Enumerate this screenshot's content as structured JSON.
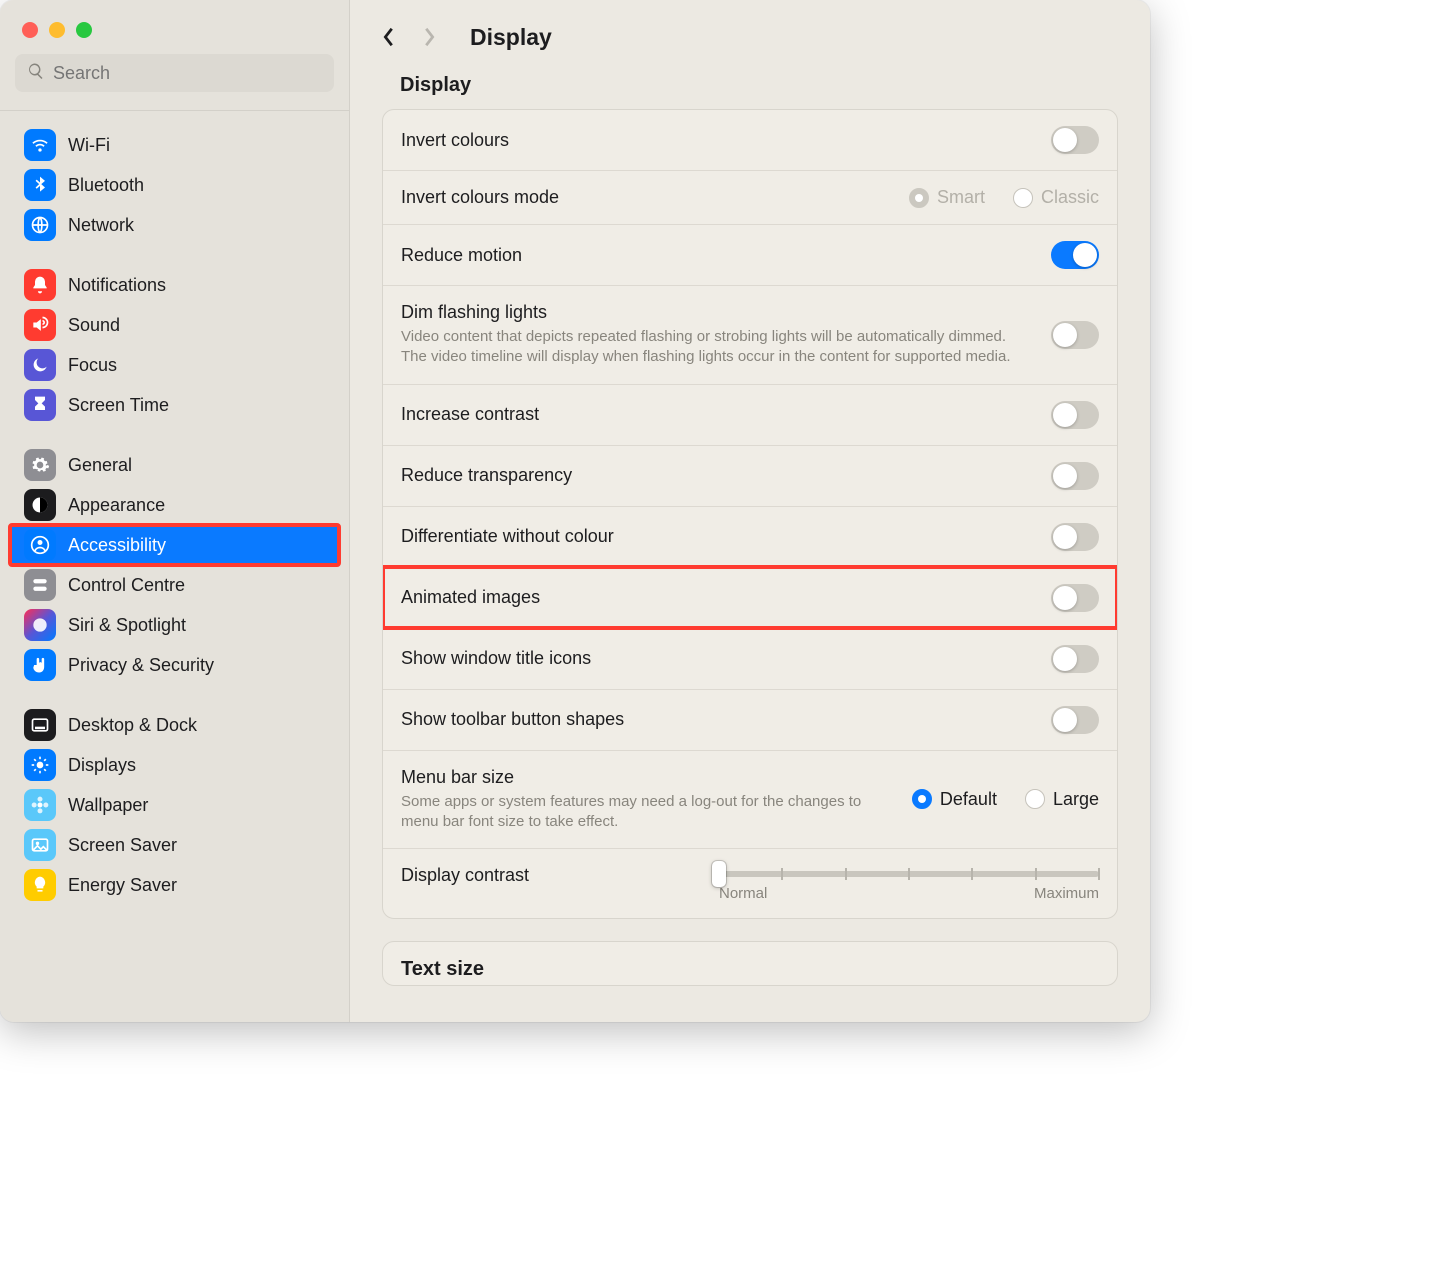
{
  "search": {
    "placeholder": "Search"
  },
  "sidebar": {
    "group1": [
      {
        "label": "Wi-Fi",
        "icon": "wifi-icon",
        "cls": "ic-wifi"
      },
      {
        "label": "Bluetooth",
        "icon": "bluetooth-icon",
        "cls": "ic-bluetooth"
      },
      {
        "label": "Network",
        "icon": "globe-icon",
        "cls": "ic-network"
      }
    ],
    "group2": [
      {
        "label": "Notifications",
        "icon": "bell-icon",
        "cls": "ic-notif"
      },
      {
        "label": "Sound",
        "icon": "speaker-icon",
        "cls": "ic-sound"
      },
      {
        "label": "Focus",
        "icon": "moon-icon",
        "cls": "ic-focus"
      },
      {
        "label": "Screen Time",
        "icon": "hourglass-icon",
        "cls": "ic-screentime"
      }
    ],
    "group3": [
      {
        "label": "General",
        "icon": "gear-icon",
        "cls": "ic-general"
      },
      {
        "label": "Appearance",
        "icon": "contrast-icon",
        "cls": "ic-appearance"
      },
      {
        "label": "Accessibility",
        "icon": "person-circle-icon",
        "cls": "ic-accessibility",
        "selected": true,
        "highlighted": true
      },
      {
        "label": "Control Centre",
        "icon": "switches-icon",
        "cls": "ic-control"
      },
      {
        "label": "Siri & Spotlight",
        "icon": "siri-icon",
        "cls": "ic-siri"
      },
      {
        "label": "Privacy & Security",
        "icon": "hand-icon",
        "cls": "ic-privacy"
      }
    ],
    "group4": [
      {
        "label": "Desktop & Dock",
        "icon": "dock-icon",
        "cls": "ic-desktop"
      },
      {
        "label": "Displays",
        "icon": "sun-icon",
        "cls": "ic-displays"
      },
      {
        "label": "Wallpaper",
        "icon": "flower-icon",
        "cls": "ic-wallpaper"
      },
      {
        "label": "Screen Saver",
        "icon": "photo-icon",
        "cls": "ic-screensaver"
      },
      {
        "label": "Energy Saver",
        "icon": "bulb-icon",
        "cls": "ic-energy"
      }
    ]
  },
  "page": {
    "title": "Display",
    "section": "Display"
  },
  "rows": {
    "invert": {
      "label": "Invert colours",
      "type": "toggle",
      "on": false
    },
    "invert_mode": {
      "label": "Invert colours mode",
      "type": "radio",
      "options": [
        {
          "label": "Smart",
          "selected": true
        },
        {
          "label": "Classic",
          "selected": false
        }
      ],
      "disabled": true
    },
    "reduce_motion": {
      "label": "Reduce motion",
      "type": "toggle",
      "on": true
    },
    "dim_flashing": {
      "label": "Dim flashing lights",
      "desc": "Video content that depicts repeated flashing or strobing lights will be automatically dimmed. The video timeline will display when flashing lights occur in the content for supported media.",
      "type": "toggle",
      "on": false
    },
    "increase_contrast": {
      "label": "Increase contrast",
      "type": "toggle",
      "on": false
    },
    "reduce_transparency": {
      "label": "Reduce transparency",
      "type": "toggle",
      "on": false
    },
    "diff_colour": {
      "label": "Differentiate without colour",
      "type": "toggle",
      "on": false
    },
    "animated": {
      "label": "Animated images",
      "type": "toggle",
      "on": false,
      "highlighted": true
    },
    "title_icons": {
      "label": "Show window title icons",
      "type": "toggle",
      "on": false
    },
    "toolbar_shapes": {
      "label": "Show toolbar button shapes",
      "type": "toggle",
      "on": false
    },
    "menubar_size": {
      "label": "Menu bar size",
      "desc": "Some apps or system features may need a log-out for the changes to menu bar font size to take effect.",
      "type": "radio",
      "options": [
        {
          "label": "Default",
          "selected": true
        },
        {
          "label": "Large",
          "selected": false
        }
      ]
    },
    "contrast_slider": {
      "label": "Display contrast",
      "type": "slider",
      "min_label": "Normal",
      "max_label": "Maximum",
      "value": 0,
      "ticks": 7
    }
  },
  "cutoff_label": "Text size"
}
